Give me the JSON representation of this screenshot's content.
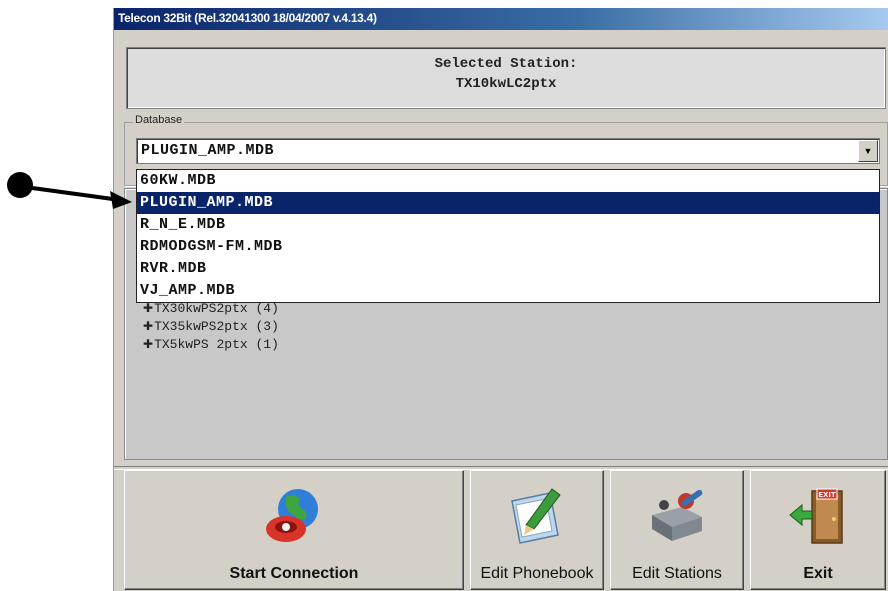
{
  "window": {
    "title": "Telecon 32Bit (Rel.32041300 18/04/2007 v.4.13.4)"
  },
  "station": {
    "heading": "Selected Station:",
    "name": "TX10kwLC2ptx"
  },
  "database": {
    "legend": "Database",
    "selected": "PLUGIN_AMP.MDB",
    "options": [
      "60KW.MDB",
      "PLUGIN_AMP.MDB",
      "R_N_E.MDB",
      "RDMODGSM-FM.MDB",
      "RVR.MDB",
      "VJ_AMP.MDB"
    ],
    "highlighted_index": 1
  },
  "tree": {
    "items": [
      "TX30kwPS2ptx (4)",
      "TX35kwPS2ptx (3)",
      "TX5kwPS 2ptx (1)"
    ]
  },
  "buttons": {
    "start": "Start Connection",
    "phonebook": "Edit Phonebook",
    "stations": "Edit Stations",
    "exit": "Exit"
  },
  "icons": {
    "combo_arrow": "chevron-down-icon",
    "start": "globe-phone-icon",
    "phonebook": "pen-paper-icon",
    "stations": "tools-icon",
    "exit": "exit-door-icon",
    "pointer": "arrow-pointer-icon"
  },
  "colors": {
    "selection": "#0a246a",
    "titlebar": "#0a246a",
    "face": "#d4d0c8"
  }
}
